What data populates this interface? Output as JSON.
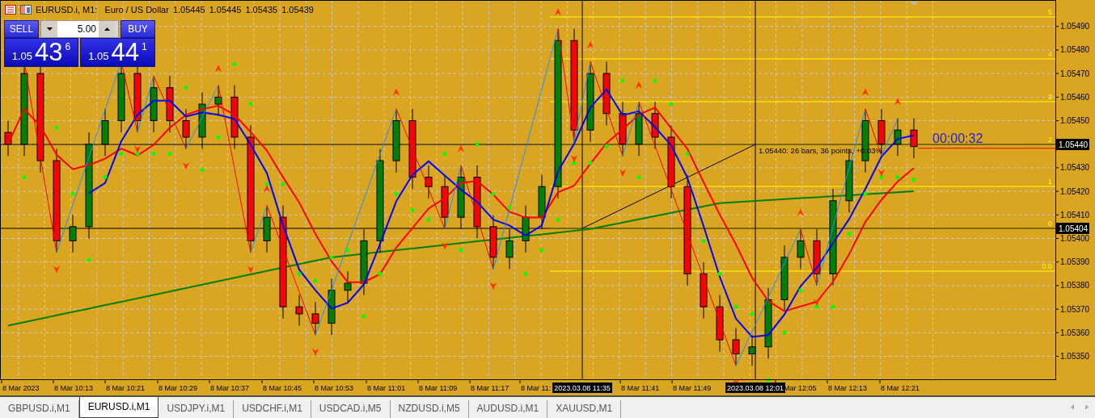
{
  "header": {
    "symbol": "EURUSD.i, M1:",
    "description": "Euro / US Dollar",
    "ohlc": [
      "1.05445",
      "1.05445",
      "1.05435",
      "1.05439"
    ]
  },
  "trade_panel": {
    "sell_label": "SELL",
    "buy_label": "BUY",
    "volume": "5.00",
    "sell_price": {
      "prefix": "1.05",
      "pips": "43",
      "fraction": "6"
    },
    "buy_price": {
      "prefix": "1.05",
      "pips": "44",
      "fraction": "1"
    }
  },
  "chart": {
    "countdown": "00:00:32",
    "fib_levels": [
      "5",
      "4",
      "3",
      "2",
      "1",
      "0",
      "0.0"
    ],
    "price_labels": [
      "1.05490",
      "1.05480",
      "1.05470",
      "1.05460",
      "1.05450",
      "1.05430",
      "1.05420",
      "1.05410",
      "1.05400",
      "1.05390",
      "1.05380",
      "1.05370",
      "1.05360",
      "1.05350"
    ],
    "price_tags": [
      "1.05440",
      "1.05404"
    ],
    "time_labels": [
      "8 Mar 2023",
      "8 Mar 10:13",
      "8 Mar 10:21",
      "8 Mar 10:29",
      "8 Mar 10:37",
      "8 Mar 10:45",
      "8 Mar 10:53",
      "8 Mar 11:01",
      "8 Mar 11:09",
      "8 Mar 11:17",
      "8 Mar 11:",
      "8 Mar 11:41",
      "8 Mar 11:49",
      "Mar 12:05",
      "8 Mar 12:13",
      "8 Mar 12:21"
    ],
    "time_tags": [
      "2023.03.08 11:35",
      "2023.03.08 12:01"
    ],
    "measurement": "1.05440: 26 bars, 36 points, +0.03%"
  },
  "tabs": [
    {
      "label": "GBPUSD.i,M1",
      "selected": false
    },
    {
      "label": "EURUSD.i,M1",
      "selected": true
    },
    {
      "label": "USDJPY.i,M1",
      "selected": false
    },
    {
      "label": "USDCHF.i,M1",
      "selected": false
    },
    {
      "label": "USDCAD.i,M5",
      "selected": false
    },
    {
      "label": "NZDUSD.i,M5",
      "selected": false
    },
    {
      "label": "AUDUSD.i,M1",
      "selected": false
    },
    {
      "label": "XAUUSD,M1",
      "selected": false
    }
  ]
}
